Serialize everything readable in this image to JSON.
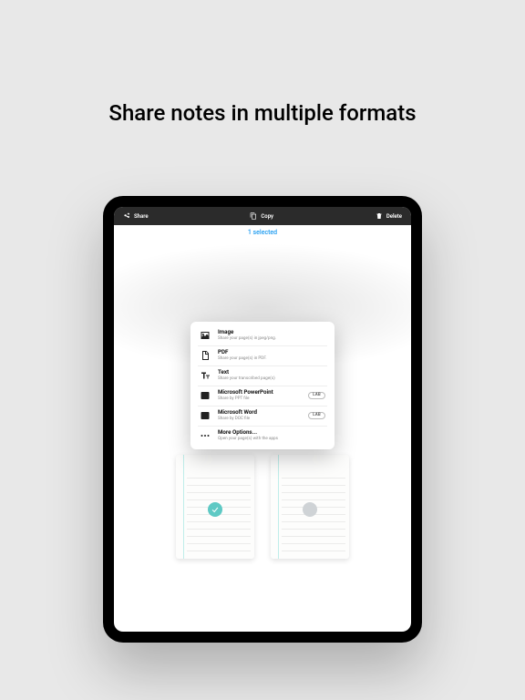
{
  "headline": "Share notes in multiple formats",
  "toolbar": {
    "share": "Share",
    "copy": "Copy",
    "delete": "Delete"
  },
  "selection": "1 selected",
  "menu": [
    {
      "title": "Image",
      "sub": "Share your page(s) in jpeg/png.",
      "icon": "image",
      "lab": false
    },
    {
      "title": "PDF",
      "sub": "Share your page(s) in PDF.",
      "icon": "pdf",
      "lab": false
    },
    {
      "title": "Text",
      "sub": "Share your transcribed page(s)",
      "icon": "text",
      "lab": false
    },
    {
      "title": "Microsoft PowerPoint",
      "sub": "Share by PPT file",
      "icon": "ppt",
      "lab": true
    },
    {
      "title": "Microsoft Word",
      "sub": "Share by DOC file",
      "icon": "word",
      "lab": true
    },
    {
      "title": "More Options...",
      "sub": "Open your page(s) with the apps",
      "icon": "more",
      "lab": false
    }
  ],
  "lab_label": "LAB",
  "notes": [
    {
      "selected": true
    },
    {
      "selected": false
    }
  ]
}
